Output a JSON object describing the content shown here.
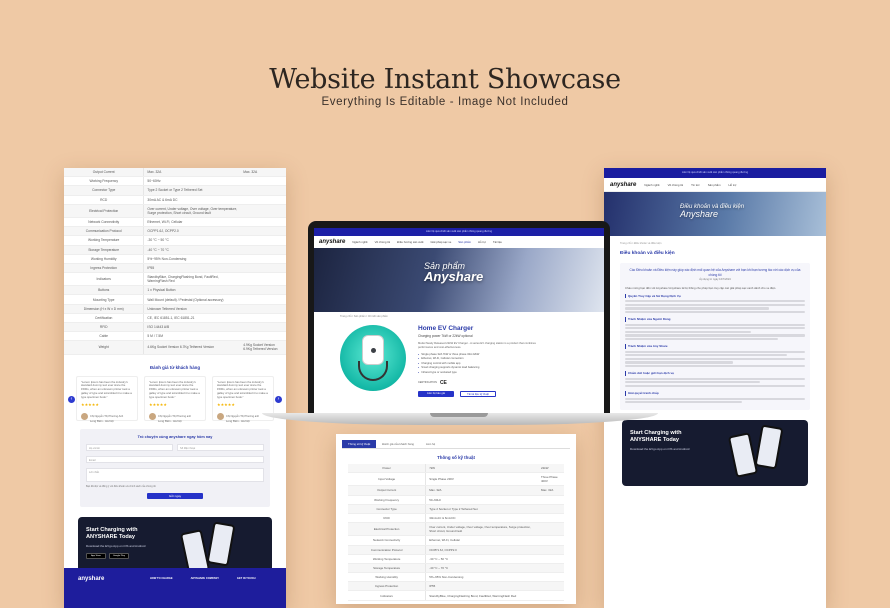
{
  "showcase": {
    "title": "Website Instant Showcase",
    "subtitle": "Everything Is Editable  -  Image Not Included"
  },
  "specs": {
    "rows": [
      [
        "Output Current",
        "Max. 32A",
        "Max. 32A"
      ],
      [
        "Working Frequency",
        "50~60Hz",
        ""
      ],
      [
        "Connector Type",
        "Type 2 Socket or Type 2 Tethered Set",
        ""
      ],
      [
        "RCD",
        "30mA AC & 6mA DC",
        ""
      ],
      [
        "Electrical Protection",
        "Over current, Under voltage, Over voltage, Over temperature, Surge protection, Short circuit, Ground fault",
        ""
      ],
      [
        "Network Connectivity",
        "Ethernet, Wi-Fi, Cellular",
        ""
      ],
      [
        "Communication Protocol",
        "OCPP1.6J, OCPP2.0",
        ""
      ],
      [
        "Working Temperature",
        "-30 °C ~ 50 °C",
        ""
      ],
      [
        "Storage Temperature",
        "-40 °C ~ 70 °C",
        ""
      ],
      [
        "Working Humidity",
        "5%~95% Non-Condensing",
        ""
      ],
      [
        "Ingress Protection",
        "IP55",
        ""
      ],
      [
        "Indicators",
        "StandbyBlue, ChargingFlashing Bond, FaultRed, WarningFlash Red",
        ""
      ],
      [
        "Buttons",
        "1 x Physical Button",
        ""
      ],
      [
        "Mounting Type",
        "Wall Mount (default) / Pedestal (Optional accessory)",
        ""
      ],
      [
        "Dimension (H x W x D mm)",
        "Unknown Tethered Version",
        ""
      ],
      [
        "Certification",
        "CE, IEC 61851-1, IEC 61851-21",
        ""
      ],
      [
        "RFID",
        "ISO 14443 A/B",
        ""
      ],
      [
        "Cable",
        "5 M / 7.5M",
        ""
      ],
      [
        "Weight",
        "4.6Kg Socket Version 6.7Kg Tethered Version",
        "4.9Kg Socket Version 6.9Kg Tethered Version"
      ]
    ]
  },
  "reviews": {
    "section_title": "Đánh giá từ khách hàng",
    "items": [
      {
        "text": "\"Lorem Ipsum has been the industry's standard dummy text ever since the 1500s, when an unknown printer took a galley of type and scrambled it to make a type specimen book.\"",
        "stars": "★★★★★",
        "name": "Chị Nguyễn Thị Phương Anh",
        "city": "Long Biên - Hà Nội"
      },
      {
        "text": "\"Lorem Ipsum has been the industry's standard dummy text ever since the 1500s, when an unknown printer took a galley of type and scrambled it to make a type specimen book.\"",
        "stars": "★★★★★",
        "name": "Chị Nguyễn Thị Phương anh",
        "city": "Long Biên - Hà Nội"
      },
      {
        "text": "\"Lorem Ipsum has been the industry's standard dummy text ever since the 1500s, when an unknown printer took a galley of type and scrambled it to make a type specimen book.\"",
        "stars": "★★★★★",
        "name": "Chị Nguyễn Thị Phương anh",
        "city": "Long Biên - Hà Nội"
      }
    ],
    "prev": "‹",
    "next": "›"
  },
  "contact_form": {
    "title": "Trò chuyện cùng anyshare ngay hôm nay",
    "name_ph": "Họ và tên",
    "phone_ph": "Số điện thoại",
    "email_ph": "Email",
    "message_ph": "Lời nhắn",
    "consent": "Bạn đã đọc và đồng ý với điều khoản và chính sách của chúng tôi",
    "submit": "Gửi ngay"
  },
  "app_promo": {
    "title": "Start Charging with ANYSHARE Today",
    "subtitle": "Download the EVgo App on iOS and Android",
    "appstore": "App Store",
    "googleplay": "Google Play"
  },
  "footer": {
    "logo": "anyshare",
    "col1": "HOW TO CHARGE",
    "col2": "ANYSHARE COMPANY",
    "col3": "GET IN TOUCH"
  },
  "site": {
    "topbar": "Liên hệ quá chiết sản xuất sản phẩm thông quang đương",
    "logo": "anyshare",
    "nav": [
      "Ngành nghề",
      "Về chúng tôi",
      "Điều hướng sản xuất",
      "Giải pháp sạc xe",
      "Tin tức",
      "Sản phẩm",
      "Hỗ trợ",
      "Hồ sơ",
      "Tài liệu"
    ]
  },
  "product_page": {
    "hero_small": "Sản phẩm",
    "hero_big": "Anyshare",
    "breadcrumb": "Trang chủ  /  Sản phẩm  /  Chi tiết sản phẩm",
    "name": "Home EV Charger",
    "subtitle": "Charging power 7kW or 22kW optional",
    "description": "Model Newly Released 22kW EV Charger - A series EV charging station is a product that combines performance and cost-effectiveness.",
    "features": [
      "Single phase 32A 7kW or three phase 32A 22kW",
      "Ethernet, Wi-Fi, Cellular connection",
      "Charging control with mobile app",
      "Smart charging supports dynamic load balancing",
      "Infrared type or socketed type"
    ],
    "cert_label": "CERTIFICATION",
    "btn_primary": "Liên hệ báo giá",
    "btn_secondary": "Tải tài liệu kỹ thuật"
  },
  "spec_tabs": {
    "tabs": [
      "Thông số kỹ thuật",
      "Đánh giá của khách hàng",
      "Liên hệ"
    ],
    "title": "Thông số kỹ thuật",
    "header": [
      "",
      "7kW",
      "22kW"
    ],
    "rows": [
      [
        "Power",
        "7kW",
        "22kW"
      ],
      [
        "Input Voltage",
        "Single Phase 230V",
        "Three Phase 400V"
      ],
      [
        "Output Current",
        "Max. 32A",
        "Max. 32A"
      ],
      [
        "Working Frequency",
        "50~60Hz",
        ""
      ],
      [
        "Connector Type",
        "Type 2 Socket or Type 2 Tethered Set",
        ""
      ],
      [
        "RCD",
        "30mA AC & 6mA DC",
        ""
      ],
      [
        "Electrical Protection",
        "Over current, Under voltage, Over voltage, Over temperature, Surge protection, Short circuit, Ground fault",
        ""
      ],
      [
        "Network Connectivity",
        "Ethernet, Wi-Fi, Cellular",
        ""
      ],
      [
        "Communication Protocol",
        "OCPP1.6J, OCPP2.0",
        ""
      ],
      [
        "Working Temperature",
        "-30 °C ~ 50 °C",
        ""
      ],
      [
        "Storage Temperature",
        "-40 °C ~ 70 °C",
        ""
      ],
      [
        "Working Humidity",
        "5%~95% Non-Condensing",
        ""
      ],
      [
        "Ingress Protection",
        "IP55",
        ""
      ],
      [
        "Indicators",
        "StandbyBlue, ChargingFlashing Bond, FaultRed, WarningFlash Red",
        ""
      ]
    ]
  },
  "terms_page": {
    "hero_line1": "Điều khoản và điều kiện",
    "hero_line2": "Anyshare",
    "breadcrumb": "Trang chủ  /  Điều khoản và điều kiện",
    "heading": "Điều khoản và điều kiện",
    "quote": "Các Điều khoản và Điều kiện này giúp xác định mối quan hệ của Anyshare với bạn khi bạn tương tác với các dịch vụ của chúng tôi",
    "quote_date": "Áp dụng từ ngày 16/7/2024",
    "intro": "Chào mừng bạn đến với Anyshare! Anyshare là hệ thống cho phép bạn truy cập các giải pháp sạc xanh dành cho xe điện.",
    "sections": [
      "Quyền Truy Cập và Sử Dụng Dịch Vụ",
      "Trách Nhiệm của Người Dùng",
      "Trách Nhiệm của Any Share",
      "Chấm dứt hoặc giới hạn dịch vụ",
      "Giải quyết tranh chấp"
    ],
    "app_title": "Start Charging with ANYSHARE Today",
    "app_sub": "Download the EVgo App on iOS and Android"
  }
}
